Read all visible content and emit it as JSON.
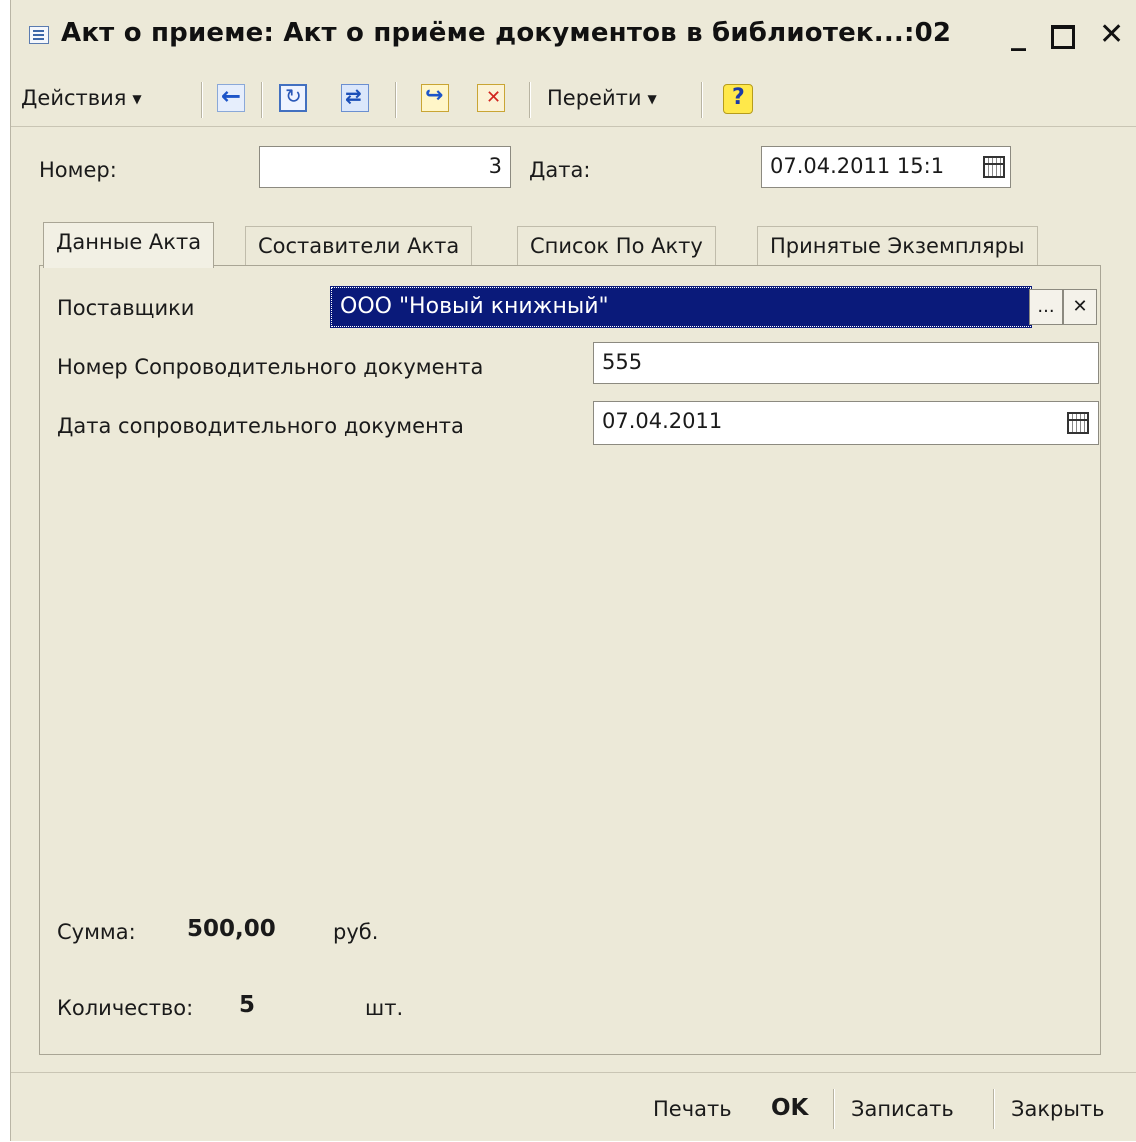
{
  "window": {
    "title": "Акт о приеме: Акт о приёме документов в библиотек...:02",
    "minimize_label": "_",
    "close_label": "✕"
  },
  "toolbar": {
    "actions_label": "Действия",
    "goto_label": "Перейти",
    "icons": [
      "back-icon",
      "refresh-icon",
      "copy-icon",
      "post-icon",
      "unpost-icon",
      "help-icon"
    ]
  },
  "header": {
    "number_label": "Номер:",
    "number_value": "3",
    "date_label": "Дата:",
    "date_value": "07.04.2011 15:1"
  },
  "tabs": [
    {
      "label": "Данные Акта",
      "active": true
    },
    {
      "label": "Составители Акта",
      "active": false
    },
    {
      "label": "Список По Акту",
      "active": false
    },
    {
      "label": "Принятые Экземпляры",
      "active": false
    }
  ],
  "form": {
    "suppliers_label": "Поставщики",
    "suppliers_value": "ООО \"Новый книжный\"",
    "select_button": "...",
    "clear_button": "✕",
    "doc_number_label": "Номер Сопроводительного документа",
    "doc_number_value": "555",
    "doc_date_label": "Дата сопроводительного документа",
    "doc_date_value": "07.04.2011"
  },
  "totals": {
    "sum_label": "Сумма:",
    "sum_value": "500,00",
    "sum_unit": "руб.",
    "qty_label": "Количество:",
    "qty_value": "5",
    "qty_unit": "шт."
  },
  "footer": {
    "print_label": "Печать",
    "ok_label": "OK",
    "save_label": "Записать",
    "close_label": "Закрыть"
  },
  "colors": {
    "window_bg": "#ece9d8",
    "selection_bg": "#0a1a7a"
  }
}
